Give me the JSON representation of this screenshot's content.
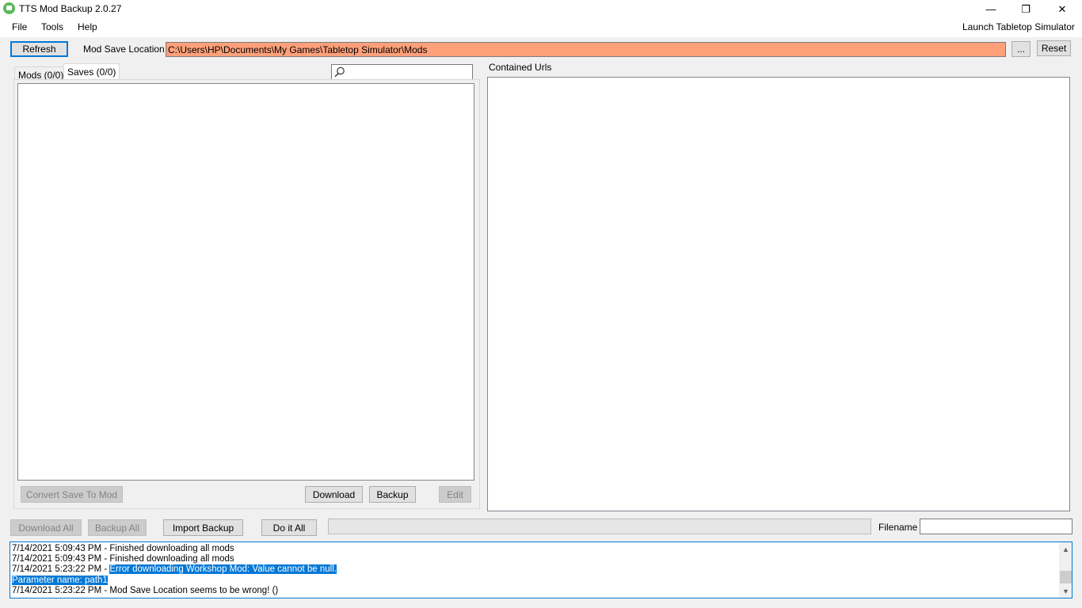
{
  "window": {
    "title": "TTS Mod Backup 2.0.27",
    "minimize_glyph": "—",
    "maximize_glyph": "❐",
    "close_glyph": "✕"
  },
  "menu": {
    "items": [
      "File",
      "Tools",
      "Help"
    ],
    "launch_label": "Launch Tabletop Simulator"
  },
  "toolbar": {
    "refresh_label": "Refresh",
    "mod_save_location_label": "Mod Save Location",
    "mod_save_location_value": "C:\\Users\\HP\\Documents\\My Games\\Tabletop Simulator\\Mods",
    "browse_label": "...",
    "reset_label": "Reset",
    "path_input_color": "#ffa07a"
  },
  "tabs": [
    {
      "label": "Mods (0/0)",
      "selected": false
    },
    {
      "label": "Saves (0/0)",
      "selected": true
    }
  ],
  "search": {
    "icon": "search-icon",
    "value": ""
  },
  "saves_panel": {
    "items": [],
    "convert_label": "Convert Save To Mod",
    "download_label": "Download",
    "backup_label": "Backup",
    "edit_label": "Edit"
  },
  "urls_panel": {
    "label": "Contained Urls",
    "items": []
  },
  "bottom_bar": {
    "download_all_label": "Download All",
    "backup_all_label": "Backup All",
    "import_backup_label": "Import Backup",
    "do_it_all_label": "Do it All",
    "progress": 0,
    "filename_label": "Filename",
    "filename_value": ""
  },
  "log": {
    "lines": [
      {
        "prefix": "7/14/2021 5:09:43 PM - Finished downloading all mods",
        "highlight": ""
      },
      {
        "prefix": "7/14/2021 5:09:43 PM - Finished downloading all mods",
        "highlight": ""
      },
      {
        "prefix": "7/14/2021 5:23:22 PM - ",
        "highlight": "Error downloading Workshop Mod: Value cannot be null."
      },
      {
        "prefix": "",
        "highlight": "Parameter name: path1"
      },
      {
        "prefix": "7/14/2021 5:23:22 PM - Mod Save Location seems to be wrong! ()",
        "highlight": ""
      }
    ],
    "scroll_up_glyph": "▲",
    "scroll_down_glyph": "▼"
  },
  "colors": {
    "accent": "#0078d7",
    "app_icon": "#5cb85c"
  }
}
